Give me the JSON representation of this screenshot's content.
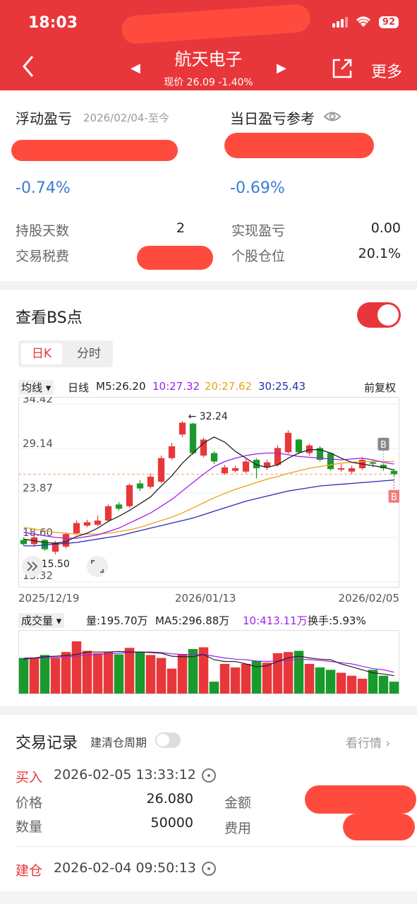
{
  "status_bar": {
    "time": "18:03",
    "battery": "92"
  },
  "nav": {
    "title": "航天电子",
    "subtitle": "现价 26.09 -1.40%",
    "more": "更多"
  },
  "summary": {
    "floating_pl_label": "浮动盈亏",
    "floating_pl_period": "2026/02/04-至今",
    "floating_pl_pct": "-0.74%",
    "daily_pl_label": "当日盈亏参考",
    "daily_pl_pct": "-0.69%",
    "holding_days_label": "持股天数",
    "holding_days": "2",
    "tax_fee_label": "交易税费",
    "realized_pl_label": "实现盈亏",
    "realized_pl": "0.00",
    "position_label": "个股仓位",
    "position": "20.1%"
  },
  "bs": {
    "title": "查看BS点",
    "tab_day": "日K",
    "tab_time": "分时",
    "ma_select": "均线",
    "ma_kind": "日线",
    "ma5": "M5:26.20",
    "ma10": "10:27.32",
    "ma20": "20:27.62",
    "ma30": "30:25.43",
    "adjust": "前复权",
    "date_start": "2025/12/19",
    "date_mid": "2026/01/13",
    "date_end": "2026/02/05",
    "vol_select": "成交量",
    "vol": "量:195.70万",
    "vol_ma5": "MA5:296.88万",
    "vol_ma10": "10:413.11万",
    "turnover": "换手:5.93%",
    "colors": {
      "up": "#e8373a",
      "down": "#1a9a2c",
      "ma5": "#222222",
      "ma10": "#a020f0",
      "ma20": "#e8a317",
      "ma30": "#2b2bb5"
    }
  },
  "chart_data": {
    "type": "candlestick",
    "y_ticks": [
      "34.42",
      "29.14",
      "23.87",
      "18.60",
      "13.32"
    ],
    "ylim": [
      13.32,
      34.42
    ],
    "max_label": "32.24",
    "min_label": "15.50",
    "marker_b_top": "B",
    "marker_b_bottom": "B",
    "candles": [
      {
        "o": 18.3,
        "c": 17.8,
        "h": 18.6,
        "l": 17.6
      },
      {
        "o": 17.8,
        "c": 18.6,
        "h": 18.9,
        "l": 17.5
      },
      {
        "o": 18.3,
        "c": 17.2,
        "h": 18.4,
        "l": 17.0
      },
      {
        "o": 16.9,
        "c": 18.0,
        "h": 18.2,
        "l": 16.6
      },
      {
        "o": 17.5,
        "c": 19.0,
        "h": 19.2,
        "l": 17.3
      },
      {
        "o": 19.1,
        "c": 20.3,
        "h": 20.6,
        "l": 18.9
      },
      {
        "o": 20.0,
        "c": 20.4,
        "h": 20.7,
        "l": 19.8
      },
      {
        "o": 20.1,
        "c": 20.6,
        "h": 21.2,
        "l": 19.9
      },
      {
        "o": 20.6,
        "c": 22.3,
        "h": 22.5,
        "l": 20.4
      },
      {
        "o": 22.5,
        "c": 22.0,
        "h": 22.8,
        "l": 21.8
      },
      {
        "o": 22.3,
        "c": 24.8,
        "h": 25.0,
        "l": 22.1
      },
      {
        "o": 25.0,
        "c": 24.4,
        "h": 25.4,
        "l": 24.1
      },
      {
        "o": 24.6,
        "c": 25.8,
        "h": 26.2,
        "l": 24.4
      },
      {
        "o": 25.2,
        "c": 28.0,
        "h": 28.3,
        "l": 25.0
      },
      {
        "o": 28.0,
        "c": 29.4,
        "h": 29.8,
        "l": 27.8
      },
      {
        "o": 30.8,
        "c": 32.2,
        "h": 32.4,
        "l": 30.5
      },
      {
        "o": 32.1,
        "c": 28.6,
        "h": 32.2,
        "l": 28.4
      },
      {
        "o": 28.3,
        "c": 30.2,
        "h": 30.4,
        "l": 28.1
      },
      {
        "o": 28.6,
        "c": 27.6,
        "h": 28.8,
        "l": 27.3
      },
      {
        "o": 26.2,
        "c": 26.9,
        "h": 27.2,
        "l": 26.0
      },
      {
        "o": 26.5,
        "c": 26.8,
        "h": 27.1,
        "l": 26.3
      },
      {
        "o": 26.4,
        "c": 27.6,
        "h": 27.9,
        "l": 26.2
      },
      {
        "o": 27.8,
        "c": 26.8,
        "h": 28.0,
        "l": 25.6
      },
      {
        "o": 26.9,
        "c": 27.5,
        "h": 27.8,
        "l": 26.6
      },
      {
        "o": 27.2,
        "c": 29.2,
        "h": 29.5,
        "l": 27.0
      },
      {
        "o": 28.7,
        "c": 31.0,
        "h": 31.3,
        "l": 28.5
      },
      {
        "o": 30.2,
        "c": 28.7,
        "h": 30.3,
        "l": 28.5
      },
      {
        "o": 28.6,
        "c": 29.5,
        "h": 29.7,
        "l": 28.3
      },
      {
        "o": 29.2,
        "c": 27.8,
        "h": 29.4,
        "l": 27.6
      },
      {
        "o": 28.6,
        "c": 26.7,
        "h": 28.7,
        "l": 26.5
      },
      {
        "o": 26.8,
        "c": 26.8,
        "h": 27.3,
        "l": 26.4
      },
      {
        "o": 26.4,
        "c": 26.8,
        "h": 27.1,
        "l": 26.1
      },
      {
        "o": 26.8,
        "c": 27.8,
        "h": 28.1,
        "l": 26.6
      },
      {
        "o": 27.5,
        "c": 27.4,
        "h": 27.8,
        "l": 26.9
      },
      {
        "o": 27.2,
        "c": 26.8,
        "h": 27.4,
        "l": 26.5
      },
      {
        "o": 26.5,
        "c": 26.1,
        "h": 26.7,
        "l": 25.9
      }
    ],
    "ma5": [
      18.4,
      18.2,
      18.0,
      17.9,
      18.1,
      18.7,
      19.1,
      19.7,
      20.5,
      21.1,
      21.8,
      22.6,
      23.4,
      24.7,
      25.9,
      27.4,
      28.6,
      29.8,
      30.5,
      29.9,
      28.8,
      28.0,
      27.2,
      26.9,
      27.2,
      28.0,
      28.6,
      29.0,
      29.0,
      28.6,
      28.0,
      27.5,
      27.3,
      27.1,
      26.9,
      26.6
    ],
    "ma10": [
      19.2,
      19.0,
      18.8,
      18.6,
      18.5,
      18.5,
      18.7,
      18.9,
      19.3,
      19.7,
      20.3,
      20.9,
      21.5,
      22.3,
      23.1,
      24.1,
      25.1,
      26.1,
      27.0,
      27.6,
      28.0,
      28.3,
      28.5,
      28.6,
      28.6,
      28.4,
      28.2,
      28.1,
      28.0,
      27.9,
      27.8,
      27.9,
      28.0,
      27.8,
      27.5,
      27.3
    ],
    "ma20": [
      19.8,
      19.6,
      19.4,
      19.2,
      19.1,
      19.0,
      19.0,
      19.0,
      19.1,
      19.3,
      19.5,
      19.8,
      20.2,
      20.6,
      21.0,
      21.5,
      22.1,
      22.7,
      23.3,
      23.8,
      24.3,
      24.7,
      25.1,
      25.5,
      25.8,
      26.2,
      26.5,
      26.8,
      27.0,
      27.2,
      27.4,
      27.5,
      27.6,
      27.6,
      27.6,
      27.6
    ],
    "ma30": [
      17.6,
      17.6,
      17.7,
      17.8,
      17.9,
      18.0,
      18.2,
      18.4,
      18.6,
      18.8,
      19.1,
      19.4,
      19.7,
      20.0,
      20.3,
      20.6,
      20.9,
      21.3,
      21.7,
      22.1,
      22.5,
      22.9,
      23.2,
      23.5,
      23.8,
      24.1,
      24.3,
      24.5,
      24.7,
      24.8,
      24.9,
      25.0,
      25.1,
      25.2,
      25.3,
      25.4
    ],
    "volumes": [
      0.6,
      0.6,
      0.65,
      0.6,
      0.7,
      0.88,
      0.72,
      0.68,
      0.7,
      0.66,
      0.77,
      0.7,
      0.65,
      0.6,
      0.42,
      0.66,
      0.75,
      0.78,
      0.2,
      0.5,
      0.44,
      0.5,
      0.55,
      0.52,
      0.68,
      0.7,
      0.72,
      0.5,
      0.44,
      0.4,
      0.35,
      0.3,
      0.25,
      0.4,
      0.3,
      0.2
    ],
    "vol_ma5": [
      0.58,
      0.6,
      0.62,
      0.63,
      0.64,
      0.66,
      0.7,
      0.7,
      0.7,
      0.71,
      0.7,
      0.7,
      0.69,
      0.68,
      0.63,
      0.62,
      0.62,
      0.66,
      0.57,
      0.54,
      0.54,
      0.5,
      0.45,
      0.47,
      0.54,
      0.6,
      0.63,
      0.6,
      0.58,
      0.57,
      0.5,
      0.45,
      0.4,
      0.35,
      0.33,
      0.3
    ],
    "vol_ma10": [
      0.6,
      0.6,
      0.6,
      0.61,
      0.62,
      0.63,
      0.65,
      0.66,
      0.67,
      0.68,
      0.69,
      0.7,
      0.7,
      0.69,
      0.67,
      0.66,
      0.66,
      0.66,
      0.63,
      0.6,
      0.58,
      0.57,
      0.55,
      0.54,
      0.55,
      0.56,
      0.58,
      0.57,
      0.56,
      0.54,
      0.52,
      0.5,
      0.46,
      0.42,
      0.4,
      0.36
    ]
  },
  "trades": {
    "title": "交易记录",
    "cycle_label": "建清仓周期",
    "view_quote": "看行情",
    "records": [
      {
        "type": "买入",
        "time": "2026-02-05 13:33:12",
        "price_label": "价格",
        "price": "26.080",
        "qty_label": "数量",
        "qty": "50000",
        "amount_label": "金额",
        "fee_label": "费用"
      },
      {
        "type": "建仓",
        "time": "2026-02-04 09:50:13"
      }
    ]
  }
}
